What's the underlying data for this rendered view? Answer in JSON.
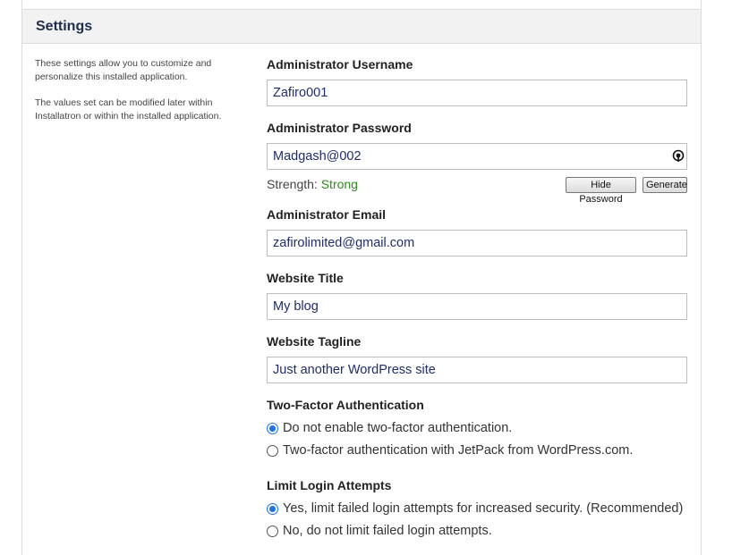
{
  "settings": {
    "title": "Settings",
    "help_1": "These settings allow you to customize and personalize this installed application.",
    "help_2": "The values set can be modified later within Installatron or within the installed application."
  },
  "fields": {
    "username": {
      "label": "Administrator Username",
      "value": "Zafiro001"
    },
    "password": {
      "label": "Administrator Password",
      "value": "Madgash@002",
      "strength_label": "Strength:",
      "strength_value": "Strong",
      "hide_button": "Hide Password",
      "generate_button": "Generate"
    },
    "email": {
      "label": "Administrator Email",
      "value": "zafirolimited@gmail.com"
    },
    "site_title": {
      "label": "Website Title",
      "value": "My blog"
    },
    "tagline": {
      "label": "Website Tagline",
      "value": "Just another WordPress site"
    }
  },
  "two_factor": {
    "label": "Two-Factor Authentication",
    "options": [
      {
        "label": "Do not enable two-factor authentication.",
        "checked": true
      },
      {
        "label": "Two-factor authentication with JetPack from WordPress.com.",
        "checked": false
      }
    ]
  },
  "limit_login": {
    "label": "Limit Login Attempts",
    "options": [
      {
        "label": "Yes, limit failed login attempts for increased security. (Recommended)",
        "checked": true
      },
      {
        "label": "No, do not limit failed login attempts.",
        "checked": false
      }
    ]
  },
  "colors": {
    "accent": "#1a73e8",
    "strength": "#2e8b1e",
    "header_bg": "#f2f2f2"
  },
  "icons": {
    "password_toggle": "eye-icon"
  }
}
